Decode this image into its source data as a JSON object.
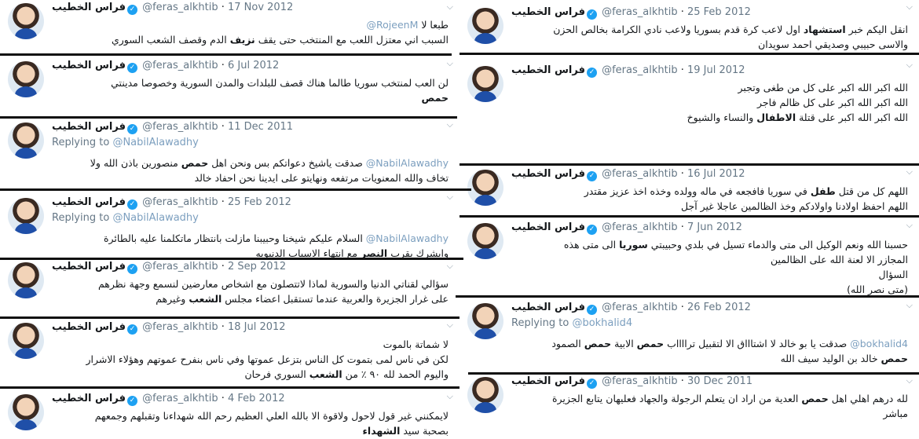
{
  "user": {
    "display_name": "فراس الخطيب",
    "handle": "@feras_alkhtib",
    "verified_glyph": "✓"
  },
  "chevron_glyph": "⌵",
  "reply_prefix": "Replying to",
  "tweets": [
    {
      "date": "17 Nov 2012",
      "lines": [
        [
          {
            "t": "طبعا لا "
          },
          {
            "t": "@RojeenM",
            "lk": true
          }
        ],
        [
          {
            "t": "السبب اني معتزل اللعب مع المنتخب حتى يقف "
          },
          {
            "t": "نزيف",
            "b": true
          },
          {
            "t": " الدم وقصف الشعب السوري"
          }
        ]
      ]
    },
    {
      "date": "6 Jul 2012",
      "lines": [
        [
          {
            "t": "لن العب لمنتخب سوريا طالما هناك قصف للبلدات والمدن السورية وخصوصا مدينتي"
          }
        ],
        [
          {
            "t": "حمص",
            "b": true
          }
        ]
      ]
    },
    {
      "date": "11 Dec 2011",
      "reply_to": "@NabilAlawadhy",
      "lines": [
        [
          {
            "t": "@NabilAlawadhy",
            "lk": true
          },
          {
            "t": " صدقت ياشيخ دعواتكم بس ونحن اهل "
          },
          {
            "t": "حمص",
            "b": true
          },
          {
            "t": " منصورين باذن الله ولا"
          }
        ],
        [
          {
            "t": "تخاف والله المعنويات مرتفعه ونهايتو على ايدينا نحن احفاد خالد"
          }
        ]
      ]
    },
    {
      "date": "25 Feb 2012",
      "reply_to": "@NabilAlawadhy",
      "lines": [
        [
          {
            "t": "@NabilAlawadhy",
            "lk": true
          },
          {
            "t": " السلام عليكم شيخنا وحبيبنا مازلت بانتظار ماتكلمنا عليه بالطائرة"
          }
        ],
        [
          {
            "t": "وابشرك بقرب "
          },
          {
            "t": "النصر",
            "b": true
          },
          {
            "t": " مع انتهاء الاسباب الدنيويه"
          }
        ]
      ]
    },
    {
      "date": "2 Sep 2012",
      "lines": [
        [
          {
            "t": "سؤالي لقناتي الدنيا والسورية لماذا لاتتصلون مع اشخاص معارضين لنسمع وجهة نظرهم"
          }
        ],
        [
          {
            "t": "على غرار الجزيرة والعربية عندما تستقبل اعضاء مجلس "
          },
          {
            "t": "الشعب",
            "b": true
          },
          {
            "t": " وغيرهم"
          }
        ]
      ]
    },
    {
      "date": "18 Jul 2012",
      "lines": [
        [
          {
            "t": "لا شماتة بالموت"
          }
        ],
        [
          {
            "t": "لكن في ناس لمى بتموت كل الناس بتزعل عموتها وفي ناس بنفرح عموتهم وهؤلاء الاشرار"
          }
        ],
        [
          {
            "t": "واليوم الحمد لله ٩٠ ٪ من "
          },
          {
            "t": "الشعب",
            "b": true
          },
          {
            "t": " السوري فرحان"
          }
        ]
      ]
    },
    {
      "date": "4 Feb 2012",
      "lines": [
        [
          {
            "t": "لايمكنني غير قول لاحول ولاقوة الا بالله العلي العظيم رحم الله شهداءنا وتقبلهم وجمعهم"
          }
        ],
        [
          {
            "t": "بصحبة سيد "
          },
          {
            "t": "الشهداء",
            "b": true
          }
        ]
      ]
    },
    {
      "date": "25 Feb 2012",
      "lines": [
        [
          {
            "t": "انقل اليكم خبر "
          },
          {
            "t": "استشهاد",
            "b": true
          },
          {
            "t": " اول لاعب كرة قدم بسوريا ولاعب نادي الكرامة بخالص الحزن"
          }
        ],
        [
          {
            "t": "والاسى حبيبي وصديقي احمد سويدان"
          }
        ]
      ]
    },
    {
      "date": "19 Jul 2012",
      "lines": [
        [
          {
            "t": "الله اكبر الله اكبر على كل من طغى وتجبر"
          }
        ],
        [
          {
            "t": " "
          }
        ],
        [
          {
            "t": "الله اكبر الله اكبر على كل ظالم فاجر"
          }
        ],
        [
          {
            "t": " "
          }
        ],
        [
          {
            "t": "الله اكبر الله اكبر على قتلة "
          },
          {
            "t": "الاطفال",
            "b": true
          },
          {
            "t": " والنساء والشيوخ"
          }
        ]
      ]
    },
    {
      "date": "16 Jul 2012",
      "lines": [
        [
          {
            "t": "اللهم كل من قتل "
          },
          {
            "t": "طفل",
            "b": true
          },
          {
            "t": " في سوريا فافجعه في ماله وولده وخذه اخذ عزيز مقتدر"
          }
        ],
        [
          {
            "t": "اللهم احفظ اولادنا واولادكم وخذ الظالمين عاجلا غير آجل"
          }
        ]
      ]
    },
    {
      "date": "7 Jun 2012",
      "lines": [
        [
          {
            "t": "حسبنا الله ونعم الوكيل الى متى والدماء تسيل في بلدي وحبيبتي "
          },
          {
            "t": "سوريا",
            "b": true
          },
          {
            "t": " الى متى هذه"
          }
        ],
        [
          {
            "t": "المجازر الا لعنة الله على الظالمين"
          }
        ],
        [
          {
            "t": "السؤال"
          }
        ],
        [
          {
            "t": "(متى نصر الله)"
          }
        ]
      ]
    },
    {
      "date": "26 Feb 2012",
      "reply_to": "@bokhalid4",
      "lines": [
        [
          {
            "t": "@bokhalid4",
            "lk": true
          },
          {
            "t": " صدقت يا بو خالد لا اشتاااق الا لتقبيل ترااااب "
          },
          {
            "t": "حمص",
            "b": true
          },
          {
            "t": " الابية "
          },
          {
            "t": "حمص",
            "b": true
          },
          {
            "t": " الصمود"
          }
        ],
        [
          {
            "t": "حمص",
            "b": true
          },
          {
            "t": " خالد بن الوليد سيف الله"
          }
        ]
      ]
    },
    {
      "date": "30 Dec 2011",
      "lines": [
        [
          {
            "t": "لله درهم اهلي اهل "
          },
          {
            "t": "حمص",
            "b": true
          },
          {
            "t": " العدية من اراد ان يتعلم الرجولة والجهاد فعليهان يتابع الجزيرة"
          }
        ],
        [
          {
            "t": "مباشر"
          }
        ]
      ]
    }
  ]
}
